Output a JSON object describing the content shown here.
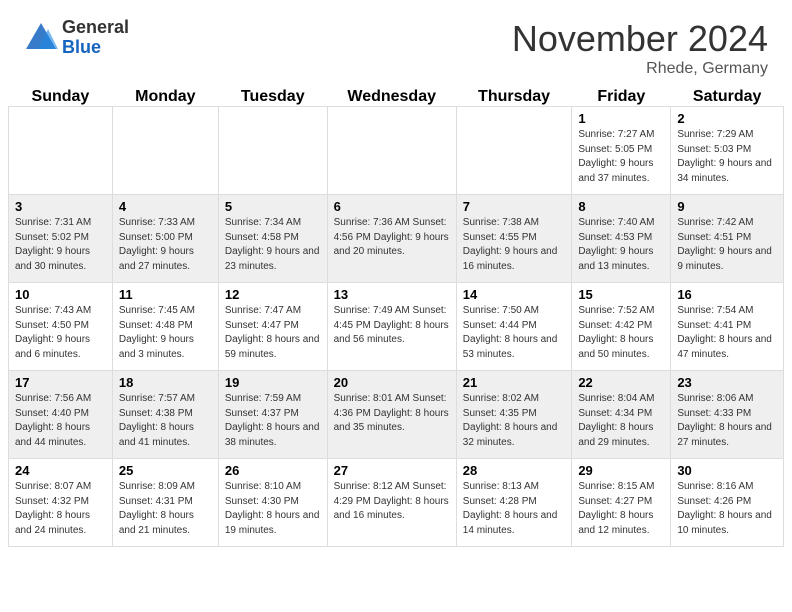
{
  "logo": {
    "general": "General",
    "blue": "Blue"
  },
  "title": "November 2024",
  "location": "Rhede, Germany",
  "days_header": [
    "Sunday",
    "Monday",
    "Tuesday",
    "Wednesday",
    "Thursday",
    "Friday",
    "Saturday"
  ],
  "weeks": [
    [
      {
        "day": "",
        "info": ""
      },
      {
        "day": "",
        "info": ""
      },
      {
        "day": "",
        "info": ""
      },
      {
        "day": "",
        "info": ""
      },
      {
        "day": "",
        "info": ""
      },
      {
        "day": "1",
        "info": "Sunrise: 7:27 AM\nSunset: 5:05 PM\nDaylight: 9 hours and 37 minutes."
      },
      {
        "day": "2",
        "info": "Sunrise: 7:29 AM\nSunset: 5:03 PM\nDaylight: 9 hours and 34 minutes."
      }
    ],
    [
      {
        "day": "3",
        "info": "Sunrise: 7:31 AM\nSunset: 5:02 PM\nDaylight: 9 hours and 30 minutes."
      },
      {
        "day": "4",
        "info": "Sunrise: 7:33 AM\nSunset: 5:00 PM\nDaylight: 9 hours and 27 minutes."
      },
      {
        "day": "5",
        "info": "Sunrise: 7:34 AM\nSunset: 4:58 PM\nDaylight: 9 hours and 23 minutes."
      },
      {
        "day": "6",
        "info": "Sunrise: 7:36 AM\nSunset: 4:56 PM\nDaylight: 9 hours and 20 minutes."
      },
      {
        "day": "7",
        "info": "Sunrise: 7:38 AM\nSunset: 4:55 PM\nDaylight: 9 hours and 16 minutes."
      },
      {
        "day": "8",
        "info": "Sunrise: 7:40 AM\nSunset: 4:53 PM\nDaylight: 9 hours and 13 minutes."
      },
      {
        "day": "9",
        "info": "Sunrise: 7:42 AM\nSunset: 4:51 PM\nDaylight: 9 hours and 9 minutes."
      }
    ],
    [
      {
        "day": "10",
        "info": "Sunrise: 7:43 AM\nSunset: 4:50 PM\nDaylight: 9 hours and 6 minutes."
      },
      {
        "day": "11",
        "info": "Sunrise: 7:45 AM\nSunset: 4:48 PM\nDaylight: 9 hours and 3 minutes."
      },
      {
        "day": "12",
        "info": "Sunrise: 7:47 AM\nSunset: 4:47 PM\nDaylight: 8 hours and 59 minutes."
      },
      {
        "day": "13",
        "info": "Sunrise: 7:49 AM\nSunset: 4:45 PM\nDaylight: 8 hours and 56 minutes."
      },
      {
        "day": "14",
        "info": "Sunrise: 7:50 AM\nSunset: 4:44 PM\nDaylight: 8 hours and 53 minutes."
      },
      {
        "day": "15",
        "info": "Sunrise: 7:52 AM\nSunset: 4:42 PM\nDaylight: 8 hours and 50 minutes."
      },
      {
        "day": "16",
        "info": "Sunrise: 7:54 AM\nSunset: 4:41 PM\nDaylight: 8 hours and 47 minutes."
      }
    ],
    [
      {
        "day": "17",
        "info": "Sunrise: 7:56 AM\nSunset: 4:40 PM\nDaylight: 8 hours and 44 minutes."
      },
      {
        "day": "18",
        "info": "Sunrise: 7:57 AM\nSunset: 4:38 PM\nDaylight: 8 hours and 41 minutes."
      },
      {
        "day": "19",
        "info": "Sunrise: 7:59 AM\nSunset: 4:37 PM\nDaylight: 8 hours and 38 minutes."
      },
      {
        "day": "20",
        "info": "Sunrise: 8:01 AM\nSunset: 4:36 PM\nDaylight: 8 hours and 35 minutes."
      },
      {
        "day": "21",
        "info": "Sunrise: 8:02 AM\nSunset: 4:35 PM\nDaylight: 8 hours and 32 minutes."
      },
      {
        "day": "22",
        "info": "Sunrise: 8:04 AM\nSunset: 4:34 PM\nDaylight: 8 hours and 29 minutes."
      },
      {
        "day": "23",
        "info": "Sunrise: 8:06 AM\nSunset: 4:33 PM\nDaylight: 8 hours and 27 minutes."
      }
    ],
    [
      {
        "day": "24",
        "info": "Sunrise: 8:07 AM\nSunset: 4:32 PM\nDaylight: 8 hours and 24 minutes."
      },
      {
        "day": "25",
        "info": "Sunrise: 8:09 AM\nSunset: 4:31 PM\nDaylight: 8 hours and 21 minutes."
      },
      {
        "day": "26",
        "info": "Sunrise: 8:10 AM\nSunset: 4:30 PM\nDaylight: 8 hours and 19 minutes."
      },
      {
        "day": "27",
        "info": "Sunrise: 8:12 AM\nSunset: 4:29 PM\nDaylight: 8 hours and 16 minutes."
      },
      {
        "day": "28",
        "info": "Sunrise: 8:13 AM\nSunset: 4:28 PM\nDaylight: 8 hours and 14 minutes."
      },
      {
        "day": "29",
        "info": "Sunrise: 8:15 AM\nSunset: 4:27 PM\nDaylight: 8 hours and 12 minutes."
      },
      {
        "day": "30",
        "info": "Sunrise: 8:16 AM\nSunset: 4:26 PM\nDaylight: 8 hours and 10 minutes."
      }
    ]
  ]
}
